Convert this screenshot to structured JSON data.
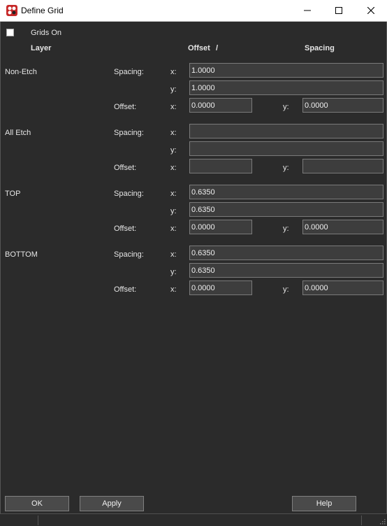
{
  "window": {
    "title": "Define Grid",
    "icon": "app-logo-icon",
    "controls": [
      "minimize-icon",
      "maximize-icon",
      "close-icon"
    ]
  },
  "grids_on": {
    "label": "Grids On",
    "checked": false
  },
  "headers": {
    "layer": "Layer",
    "offset": "Offset",
    "slash": "/",
    "spacing": "Spacing"
  },
  "labels": {
    "spacing": "Spacing:",
    "offset": "Offset:",
    "x": "x:",
    "y": "y:"
  },
  "layers": [
    {
      "name": "Non-Etch",
      "spacing_x": "1.0000",
      "spacing_y": "1.0000",
      "offset_x": "0.0000",
      "offset_y": "0.0000"
    },
    {
      "name": "All Etch",
      "spacing_x": "",
      "spacing_y": "",
      "offset_x": "",
      "offset_y": ""
    },
    {
      "name": "TOP",
      "spacing_x": "0.6350",
      "spacing_y": "0.6350",
      "offset_x": "0.0000",
      "offset_y": "0.0000"
    },
    {
      "name": "BOTTOM",
      "spacing_x": "0.6350",
      "spacing_y": "0.6350",
      "offset_x": "0.0000",
      "offset_y": "0.0000"
    }
  ],
  "buttons": {
    "ok": "OK",
    "apply": "Apply",
    "help": "Help"
  },
  "colors": {
    "background": "#2b2b2b",
    "field": "#3d3d3d",
    "button": "#4a4a4a",
    "titlebar": "#ffffff",
    "app_icon": "#c62828"
  }
}
